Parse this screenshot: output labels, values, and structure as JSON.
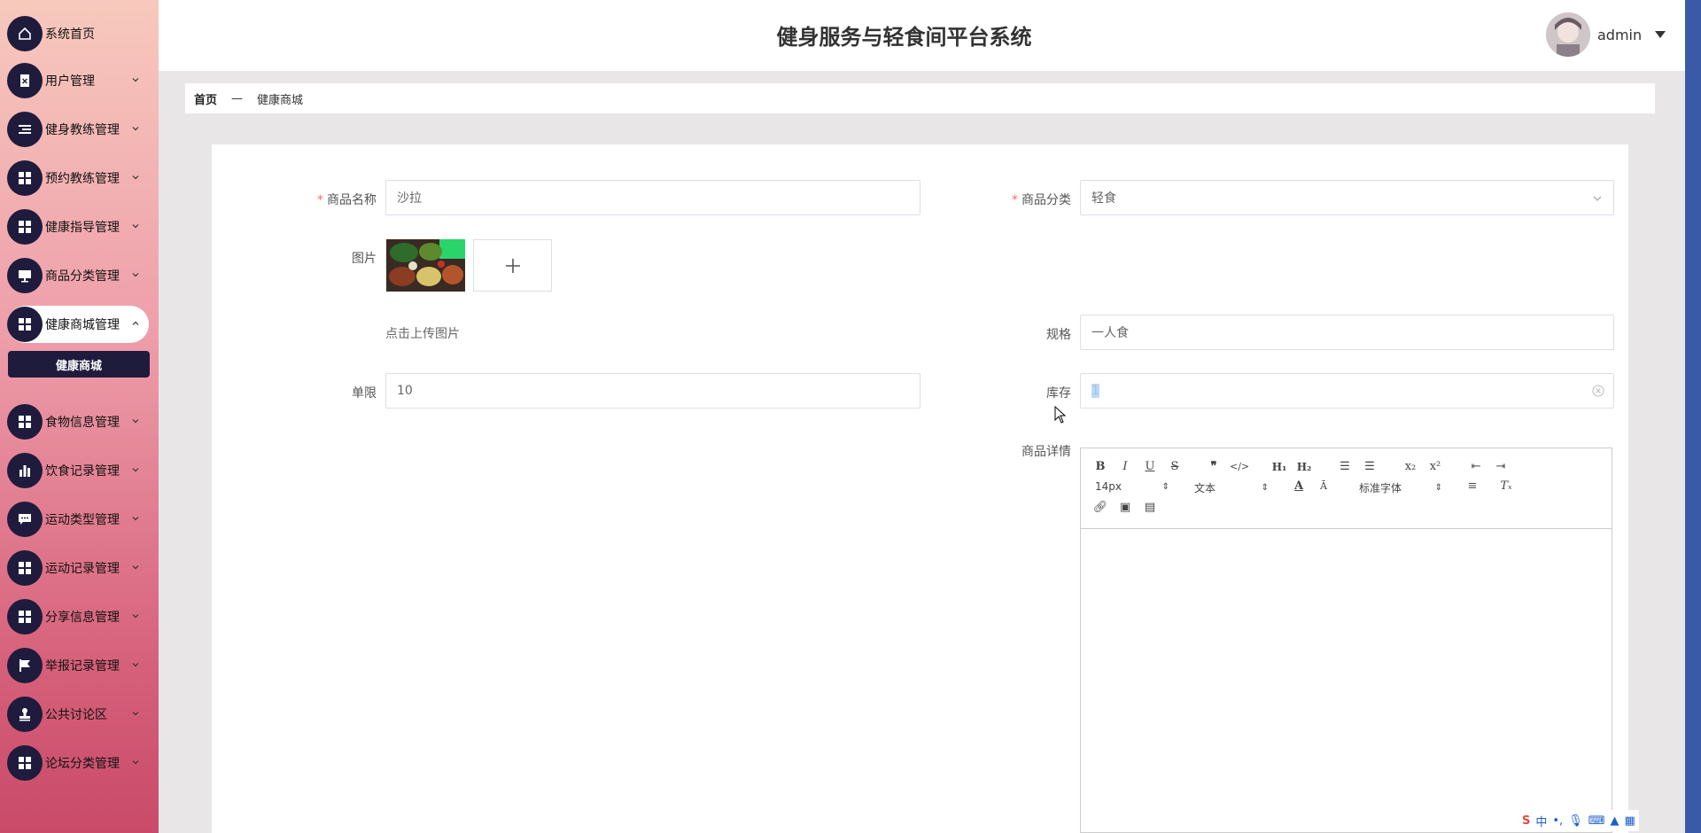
{
  "app": {
    "title": "健身服务与轻食间平台系统"
  },
  "user": {
    "name": "admin"
  },
  "sidebar": {
    "items": [
      {
        "label": "系统首页",
        "icon": "home-icon"
      },
      {
        "label": "用户管理",
        "icon": "user-clipboard-icon"
      },
      {
        "label": "健身教练管理",
        "icon": "list-icon"
      },
      {
        "label": "预约教练管理",
        "icon": "grid-icon"
      },
      {
        "label": "健康指导管理",
        "icon": "grid-icon"
      },
      {
        "label": "商品分类管理",
        "icon": "monitor-icon"
      },
      {
        "label": "健康商城管理",
        "icon": "grid-icon"
      },
      {
        "label": "食物信息管理",
        "icon": "grid-icon"
      },
      {
        "label": "饮食记录管理",
        "icon": "bar-chart-icon"
      },
      {
        "label": "运动类型管理",
        "icon": "chat-icon"
      },
      {
        "label": "运动记录管理",
        "icon": "grid-icon"
      },
      {
        "label": "分享信息管理",
        "icon": "grid-icon"
      },
      {
        "label": "举报记录管理",
        "icon": "flag-icon"
      },
      {
        "label": "公共讨论区",
        "icon": "stamp-icon"
      },
      {
        "label": "论坛分类管理",
        "icon": "grid-icon"
      }
    ],
    "submenu": {
      "label": "健康商城"
    }
  },
  "breadcrumb": {
    "home": "首页",
    "sep": "—",
    "current": "健康商城"
  },
  "form": {
    "name_label": "商品名称",
    "name_value": "沙拉",
    "category_label": "商品分类",
    "category_value": "轻食",
    "image_label": "图片",
    "upload_tip": "点击上传图片",
    "spec_label": "规格",
    "spec_value": "一人食",
    "limit_label": "单限",
    "limit_value": "10",
    "stock_label": "库存",
    "stock_value": "1",
    "detail_label": "商品详情",
    "required_mark": "*"
  },
  "editor": {
    "size": "14px",
    "header": "文本",
    "font": "标准字体"
  },
  "ime": {
    "lang": "中"
  },
  "colors": {
    "sidebar_dark": "#1f1b3d",
    "required": "#f56c6c",
    "accent_blue": "#3a5aa8"
  }
}
